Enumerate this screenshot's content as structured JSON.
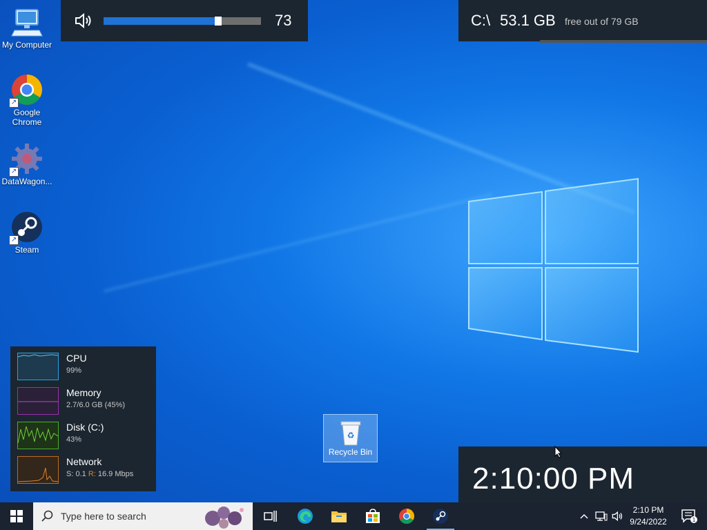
{
  "desktop": {
    "icons": [
      {
        "label": "My Computer"
      },
      {
        "label": "Google Chrome"
      },
      {
        "label": "DataWagon..."
      },
      {
        "label": "Steam"
      }
    ],
    "recycle_bin": {
      "label": "Recycle Bin"
    }
  },
  "volume_osd": {
    "value": 73,
    "value_text": "73",
    "level_fraction": 0.73
  },
  "disk_overlay": {
    "drive": "C:\\",
    "free": "53.1 GB",
    "detail": "free out of 79 GB"
  },
  "performance": [
    {
      "name": "CPU",
      "value": "99%",
      "color": "#2aa0e8"
    },
    {
      "name": "Memory",
      "value": "2.7/6.0 GB (45%)",
      "color": "#9b2fae"
    },
    {
      "name": "Disk (C:)",
      "value": "43%",
      "color": "#4caf24"
    },
    {
      "name": "Network",
      "value_s": "S: 0.1",
      "value_r_label": "R:",
      "value_r": "16.9 Mbps",
      "color": "#c26a1e"
    }
  ],
  "clock_overlay": {
    "time": "2:10:00 PM"
  },
  "taskbar": {
    "search_placeholder": "Type here to search",
    "time": "2:10 PM",
    "date": "9/24/2022",
    "notification_count": "1"
  },
  "colors": {
    "accent": "#1e73d4",
    "taskbar": "#1b2230",
    "panel": "#1c2630"
  }
}
